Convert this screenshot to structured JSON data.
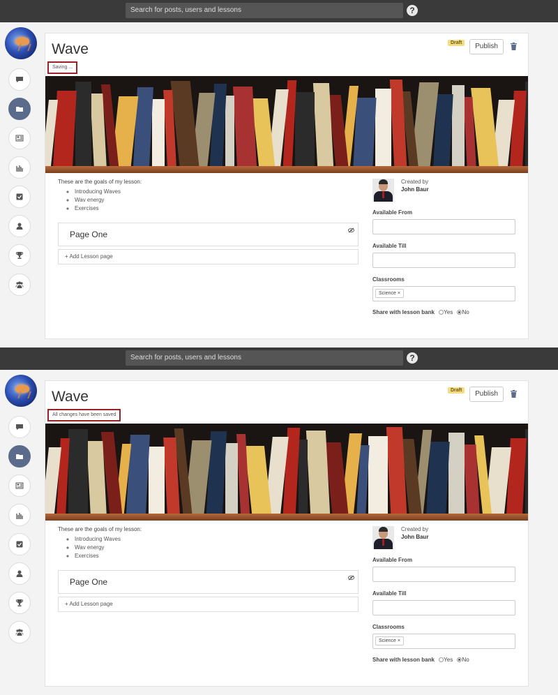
{
  "header": {
    "search_placeholder": "Search for posts, users and lessons",
    "help_label": "?"
  },
  "sidebar": {
    "items": [
      "chat-icon",
      "folder-icon",
      "news-icon",
      "chart-icon",
      "checkbox-icon",
      "user-icon",
      "trophy-icon",
      "group-icon"
    ],
    "active_item": "folder-icon"
  },
  "lesson": {
    "title": "Wave",
    "draft_badge": "Draft",
    "publish_label": "Publish",
    "goals_intro": "These are the goals of my lesson:",
    "goals": [
      "Introducing Waves",
      "Wav energy",
      "Exercises"
    ],
    "page_title": "Page One",
    "add_page_label": "+ Add Lesson page",
    "created_by_label": "Created by",
    "author": "John Baur",
    "available_from_label": "Available From",
    "available_till_label": "Available Till",
    "classrooms_label": "Classrooms",
    "classroom_tag": "Science",
    "tag_remove": "×",
    "share_label": "Share with lesson bank",
    "share_yes": "Yes",
    "share_no": "No",
    "share_selected": "No"
  },
  "screens": [
    {
      "status_text": "Saving ..."
    },
    {
      "status_text": "All changes have been saved"
    }
  ]
}
